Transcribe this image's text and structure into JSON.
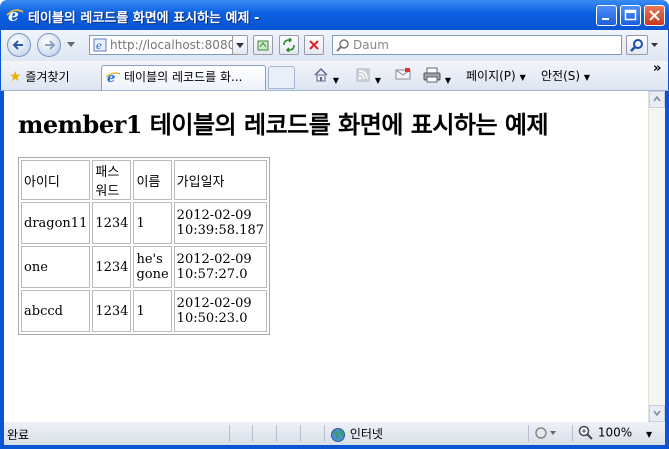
{
  "window": {
    "title": "테이블의 레코드를 화면에 표시하는 예제 -"
  },
  "toolbar": {
    "address": "http://localhost:8080",
    "search_placeholder": "Daum"
  },
  "favorites": {
    "label": "즐겨찾기"
  },
  "tab": {
    "title": "테이블의 레코드를 화..."
  },
  "commandbar": {
    "page_label": "페이지(P)",
    "safety_label": "안전(S)"
  },
  "page": {
    "heading": "member1 테이블의 레코드를 화면에 표시하는 예제",
    "columns": [
      "아이디",
      "패스워드",
      "이름",
      "가입일자"
    ],
    "rows": [
      {
        "id": "dragon11",
        "password": "1234",
        "name": "1",
        "date": "2012-02-09",
        "time": "10:39:58.187"
      },
      {
        "id": "one",
        "password": "1234",
        "name": "he's gone",
        "date": "2012-02-09",
        "time": "10:57:27.0"
      },
      {
        "id": "abccd",
        "password": "1234",
        "name": "1",
        "date": "2012-02-09",
        "time": "10:50:23.0"
      }
    ]
  },
  "statusbar": {
    "status": "완료",
    "zone": "인터넷",
    "zoom": "100%"
  }
}
